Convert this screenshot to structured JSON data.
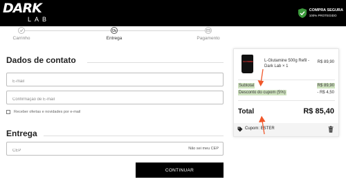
{
  "brand": {
    "logo_text": "DARK",
    "logo_sub": "LAB"
  },
  "secure_badge": {
    "line1": "COMPRA SEGURA",
    "line2": "100% PROTEGIDO",
    "color": "#3c9a3c"
  },
  "steps": [
    {
      "label": "Carrinho",
      "active": false
    },
    {
      "label": "Entrega",
      "active": true
    },
    {
      "label": "Pagamento",
      "active": false
    }
  ],
  "contact": {
    "title": "Dados de contato",
    "email_placeholder": "E-mail",
    "email_confirm_placeholder": "Confirmação de E-mail",
    "newsletter_label": "Receber ofertas e novidades por e-mail"
  },
  "delivery": {
    "title": "Entrega",
    "cep_placeholder": "CEP",
    "unknown_cep_link": "Não sei meu CEP"
  },
  "continue_label": "CONTINUAR",
  "summary": {
    "product_name": "L-Glutamine 500g Refil - Dark Lab × 1",
    "product_label": "GLUTAMINE",
    "product_price": "R$ 89,90",
    "subtotal_label": "Subtotal",
    "subtotal_value": "R$ 89,90",
    "discount_label": "Desconto do cupom (5%)",
    "discount_value": "- R$ 4,50",
    "total_label": "Total",
    "total_value": "R$ 85,40",
    "coupon_text": "Cupom: ESTER",
    "highlight_color": "#cfe3bf",
    "arrow_color": "#f0572a"
  }
}
